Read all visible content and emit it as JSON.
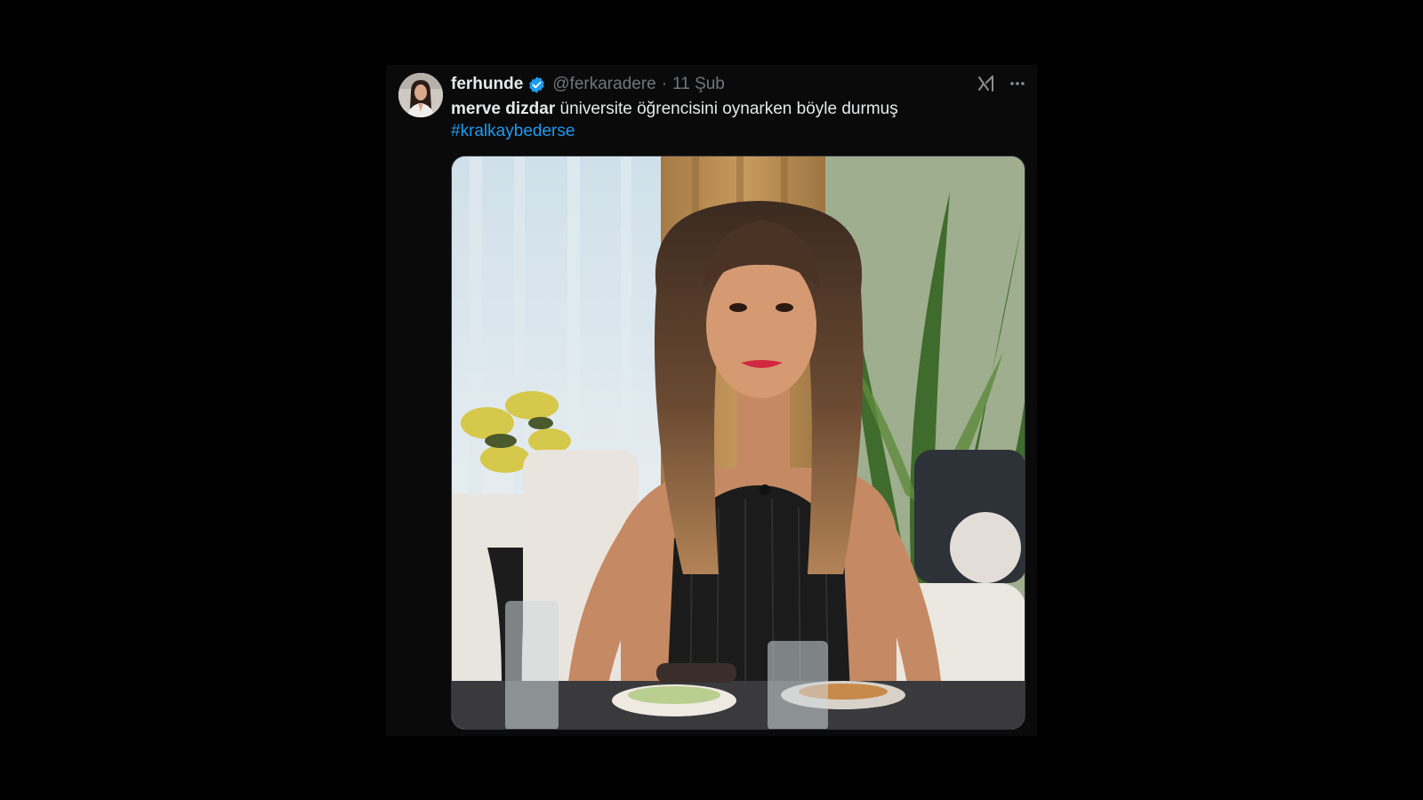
{
  "tweet": {
    "display_name": "ferhunde",
    "verified": true,
    "handle": "@ferkaradere",
    "separator": "·",
    "date": "11 Şub",
    "text_mention": "merve dizdar",
    "text_body": " üniversite öğrencisini oynarken böyle durmuş",
    "hashtag": "#kralkaybederse"
  },
  "icons": {
    "verified": "verified-badge-icon",
    "grok": "grok-icon",
    "more": "more-options-icon"
  },
  "colors": {
    "background": "#000000",
    "card": "#0a0a0a",
    "text_primary": "#e7e9ea",
    "text_secondary": "#71767b",
    "link": "#1d9bf0",
    "verified": "#1d9bf0"
  }
}
